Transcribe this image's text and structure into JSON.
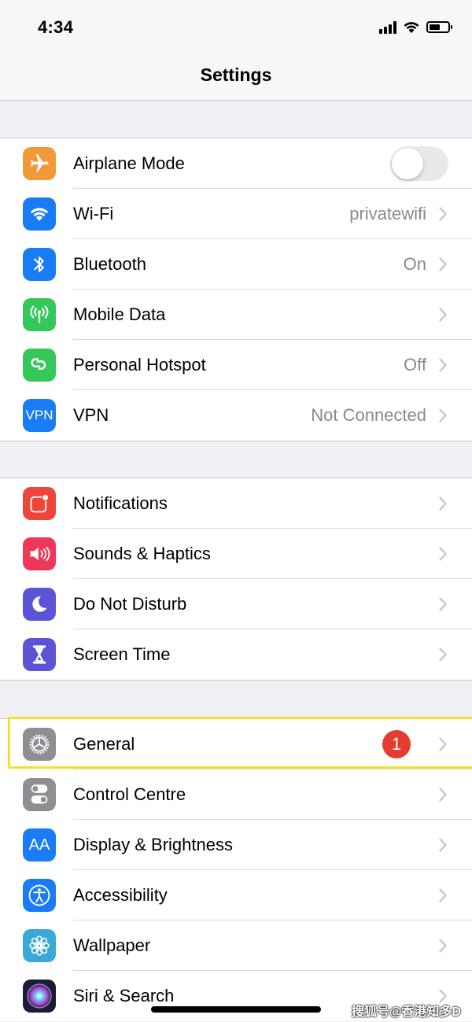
{
  "status_bar": {
    "time": "4:34",
    "icons": [
      "cellular-signal-icon",
      "wifi-icon",
      "battery-icon"
    ]
  },
  "nav": {
    "title": "Settings"
  },
  "groups": [
    {
      "items": [
        {
          "label": "Airplane Mode",
          "icon": "airplane-icon",
          "icon_color": "#f19a37",
          "control": "toggle",
          "toggle_on": false
        },
        {
          "label": "Wi-Fi",
          "icon": "wifi-icon",
          "icon_color": "#1a7cf4",
          "value": "privatewifi"
        },
        {
          "label": "Bluetooth",
          "icon": "bluetooth-icon",
          "icon_color": "#1a7cf4",
          "value": "On"
        },
        {
          "label": "Mobile Data",
          "icon": "antenna-icon",
          "icon_color": "#34c759",
          "value": ""
        },
        {
          "label": "Personal Hotspot",
          "icon": "hotspot-icon",
          "icon_color": "#34c759",
          "value": "Off"
        },
        {
          "label": "VPN",
          "icon": "vpn-icon",
          "icon_color": "#1a7cf4",
          "icon_text": "VPN",
          "value": "Not Connected"
        }
      ]
    },
    {
      "items": [
        {
          "label": "Notifications",
          "icon": "notifications-icon",
          "icon_color": "#f0463a"
        },
        {
          "label": "Sounds & Haptics",
          "icon": "speaker-icon",
          "icon_color": "#f0375a"
        },
        {
          "label": "Do Not Disturb",
          "icon": "moon-icon",
          "icon_color": "#5b55d6"
        },
        {
          "label": "Screen Time",
          "icon": "hourglass-icon",
          "icon_color": "#5b55d6"
        }
      ]
    },
    {
      "items": [
        {
          "label": "General",
          "icon": "gear-icon",
          "icon_color": "#8e8e93",
          "badge": "1",
          "highlighted": true
        },
        {
          "label": "Control Centre",
          "icon": "toggles-icon",
          "icon_color": "#8e8e93"
        },
        {
          "label": "Display & Brightness",
          "icon": "text-size-icon",
          "icon_color": "#1a7cf4",
          "icon_text": "AA"
        },
        {
          "label": "Accessibility",
          "icon": "accessibility-icon",
          "icon_color": "#1a7cf4"
        },
        {
          "label": "Wallpaper",
          "icon": "flower-icon",
          "icon_color": "#3aa9d8"
        },
        {
          "label": "Siri & Search",
          "icon": "siri-icon",
          "icon_color": "#1b1b3a"
        }
      ]
    }
  ],
  "highlight_color": "#f2e22e",
  "watermark": "搜狐号@香港知多D"
}
